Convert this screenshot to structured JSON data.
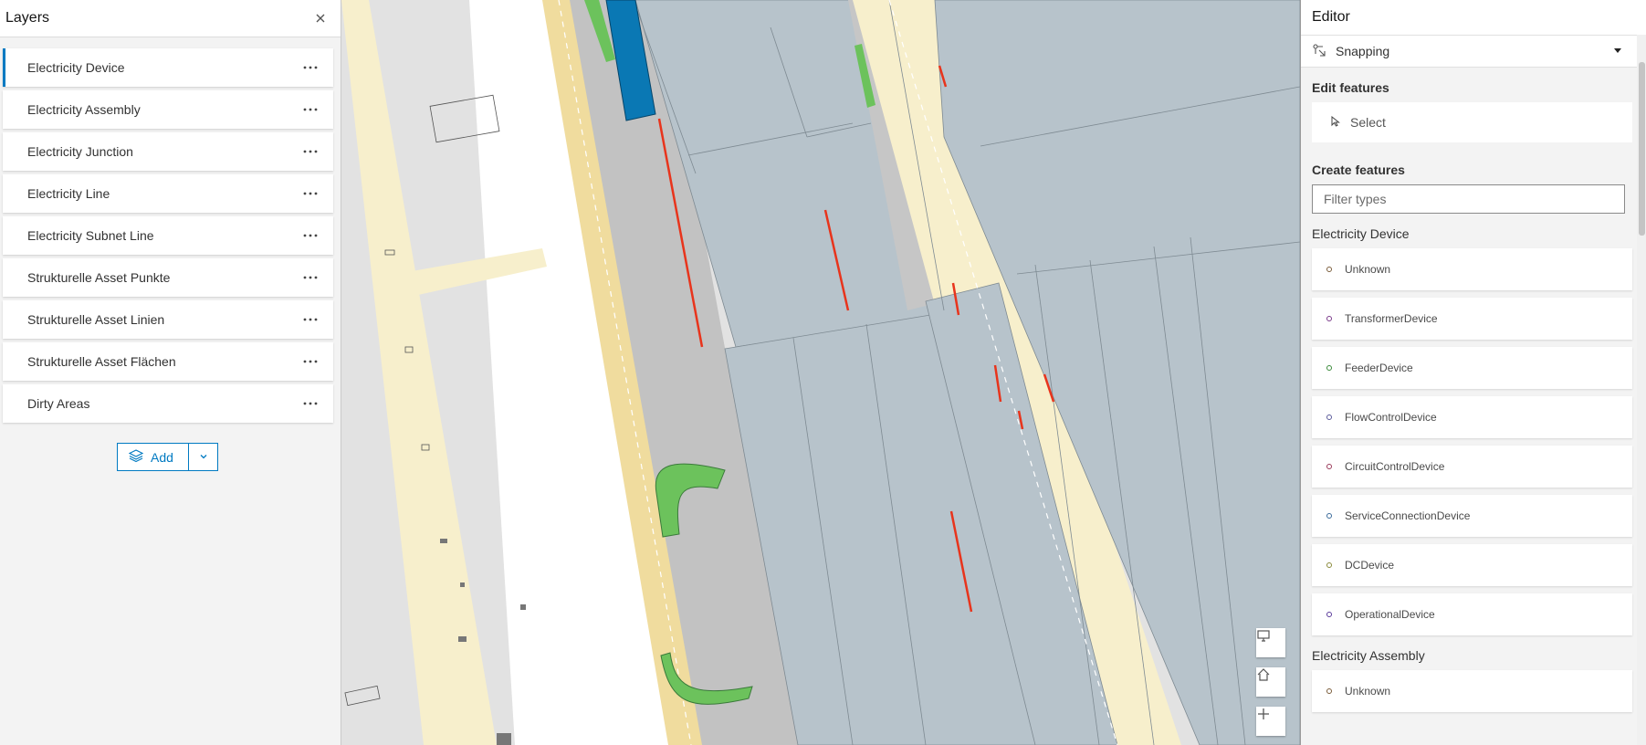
{
  "layers": {
    "title": "Layers",
    "items": [
      {
        "label": "Electricity Device"
      },
      {
        "label": "Electricity Assembly"
      },
      {
        "label": "Electricity Junction"
      },
      {
        "label": "Electricity Line"
      },
      {
        "label": "Electricity Subnet Line"
      },
      {
        "label": "Strukturelle Asset Punkte"
      },
      {
        "label": "Strukturelle Asset Linien"
      },
      {
        "label": "Strukturelle Asset Flächen"
      },
      {
        "label": "Dirty Areas"
      }
    ],
    "add_label": "Add"
  },
  "editor": {
    "title": "Editor",
    "snapping_label": "Snapping",
    "edit_features_title": "Edit features",
    "select_label": "Select",
    "create_features_title": "Create features",
    "filter_placeholder": "Filter types",
    "groups": [
      {
        "name": "Electricity Device",
        "types": [
          {
            "label": "Unknown",
            "color": "#7a5c3a"
          },
          {
            "label": "TransformerDevice",
            "color": "#7a3a8a"
          },
          {
            "label": "FeederDevice",
            "color": "#3a8a3a"
          },
          {
            "label": "FlowControlDevice",
            "color": "#5a5a9a"
          },
          {
            "label": "CircuitControlDevice",
            "color": "#9a3a5a"
          },
          {
            "label": "ServiceConnectionDevice",
            "color": "#3a6a9a"
          },
          {
            "label": "DCDevice",
            "color": "#8a8a3a"
          },
          {
            "label": "OperationalDevice",
            "color": "#5a3a9a"
          }
        ]
      },
      {
        "name": "Electricity Assembly",
        "types": [
          {
            "label": "Unknown",
            "color": "#7a5c3a"
          }
        ]
      }
    ]
  },
  "map": {
    "colors": {
      "building": "#b7c3cb",
      "street": "#f7efcc",
      "road_main": "#f0dc9e",
      "pavement": "#c2c2c2",
      "open": "#ffffff",
      "ground": "#e2e2e2",
      "green": "#6cc25c",
      "blue": "#0a78b4",
      "red_line": "#e8341c"
    },
    "controls": [
      "screen-icon",
      "home-icon",
      "zoom-in-icon"
    ]
  },
  "theme": {
    "accent": "#007ac2"
  }
}
